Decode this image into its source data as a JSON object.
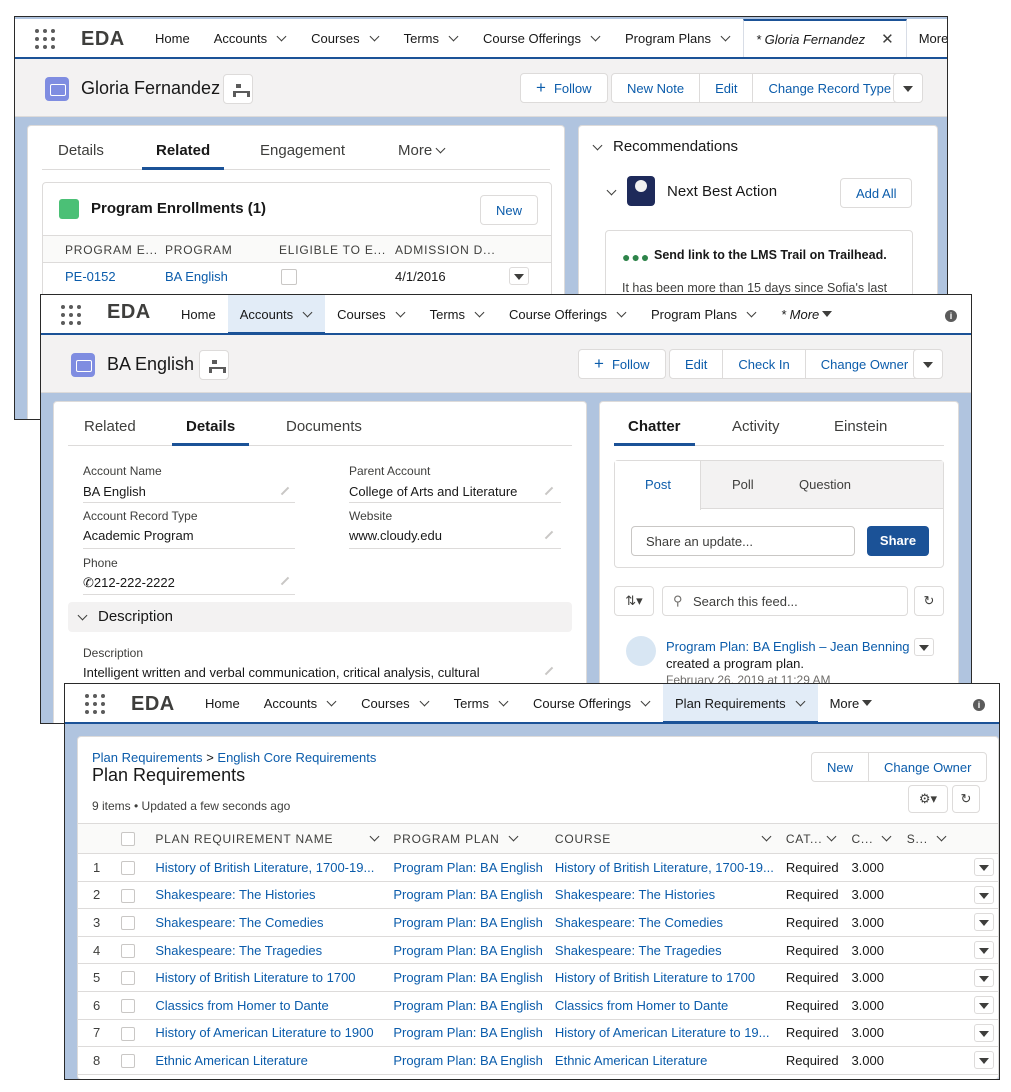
{
  "window1": {
    "app_name": "EDA",
    "nav": [
      "Home",
      "Accounts",
      "Courses",
      "Terms",
      "Course Offerings",
      "Program Plans"
    ],
    "open_tab": "* Gloria Fernandez",
    "more": "More",
    "record_title": "Gloria Fernandez",
    "actions": {
      "follow": "Follow",
      "new_note": "New Note",
      "edit": "Edit",
      "change_record_type": "Change Record Type"
    },
    "tabs": [
      "Details",
      "Related",
      "Engagement",
      "More"
    ],
    "enrollments": {
      "title": "Program Enrollments (1)",
      "new": "New",
      "headers": [
        "PROGRAM E...",
        "PROGRAM",
        "ELIGIBLE TO E...",
        "ADMISSION D..."
      ],
      "row": {
        "id": "PE-0152",
        "program": "BA English",
        "date": "4/1/2016"
      }
    },
    "recommendations": {
      "title": "Recommendations",
      "nba": "Next Best Action",
      "add_all": "Add All",
      "item_title": "Send link to the LMS Trail on Trailhead.",
      "item_text": "It has been more than 15 days since Sofia's last"
    }
  },
  "window2": {
    "app_name": "EDA",
    "nav": [
      "Home",
      "Accounts",
      "Courses",
      "Terms",
      "Course Offerings",
      "Program Plans"
    ],
    "more": "* More",
    "record_title": "BA English",
    "actions": {
      "follow": "Follow",
      "edit": "Edit",
      "check_in": "Check In",
      "change_owner": "Change Owner"
    },
    "tabs": [
      "Related",
      "Details",
      "Documents"
    ],
    "fields": {
      "account_name_label": "Account Name",
      "account_name": "BA English",
      "parent_account_label": "Parent Account",
      "parent_account": "College of Arts and Literature",
      "record_type_label": "Account Record Type",
      "record_type": "Academic Program",
      "website_label": "Website",
      "website": "www.cloudy.edu",
      "phone_label": "Phone",
      "phone": "212-222-2222"
    },
    "description_section": "Description",
    "description_label": "Description",
    "description": "Intelligent written and verbal communication, critical analysis, cultural",
    "chatter_tabs": [
      "Chatter",
      "Activity",
      "Einstein"
    ],
    "post_tabs": [
      "Post",
      "Poll",
      "Question"
    ],
    "share_placeholder": "Share an update...",
    "share": "Share",
    "search_feed": "Search this feed...",
    "feed": {
      "link": "Program Plan: BA English – Jean Benning",
      "text": "created a program plan.",
      "date": "February 26, 2019 at 11:29 AM"
    }
  },
  "window3": {
    "app_name": "EDA",
    "nav": [
      "Home",
      "Accounts",
      "Courses",
      "Terms",
      "Course Offerings"
    ],
    "active_nav": "Plan Requirements",
    "more": "More",
    "breadcrumb_parent": "Plan Requirements",
    "breadcrumb_sep": ">",
    "breadcrumb_child": "English Core Requirements",
    "title": "Plan Requirements",
    "status": "9 items • Updated a few seconds ago",
    "new": "New",
    "change_owner": "Change Owner",
    "headers": [
      "PLAN REQUIREMENT NAME",
      "PROGRAM PLAN",
      "COURSE",
      "CAT...",
      "C...",
      "S..."
    ],
    "rows": [
      {
        "n": "1",
        "name": "History of British Literature, 1700-19...",
        "plan": "Program Plan: BA English",
        "course": "History of British Literature, 1700-19...",
        "cat": "Required",
        "c": "3.000"
      },
      {
        "n": "2",
        "name": "Shakespeare: The Histories",
        "plan": "Program Plan: BA English",
        "course": "Shakespeare: The Histories",
        "cat": "Required",
        "c": "3.000"
      },
      {
        "n": "3",
        "name": "Shakespeare: The Comedies",
        "plan": "Program Plan: BA English",
        "course": "Shakespeare: The Comedies",
        "cat": "Required",
        "c": "3.000"
      },
      {
        "n": "4",
        "name": "Shakespeare: The Tragedies",
        "plan": "Program Plan: BA English",
        "course": "Shakespeare: The Tragedies",
        "cat": "Required",
        "c": "3.000"
      },
      {
        "n": "5",
        "name": "History of British Literature to 1700",
        "plan": "Program Plan: BA English",
        "course": "History of British Literature to 1700",
        "cat": "Required",
        "c": "3.000"
      },
      {
        "n": "6",
        "name": "Classics from Homer to Dante",
        "plan": "Program Plan: BA English",
        "course": "Classics from Homer to Dante",
        "cat": "Required",
        "c": "3.000"
      },
      {
        "n": "7",
        "name": "History of American Literature to 1900",
        "plan": "Program Plan: BA English",
        "course": "History of American Literature to 19...",
        "cat": "Required",
        "c": "3.000"
      },
      {
        "n": "8",
        "name": "Ethnic American Literature",
        "plan": "Program Plan: BA English",
        "course": "Ethnic American Literature",
        "cat": "Required",
        "c": "3.000"
      }
    ]
  }
}
